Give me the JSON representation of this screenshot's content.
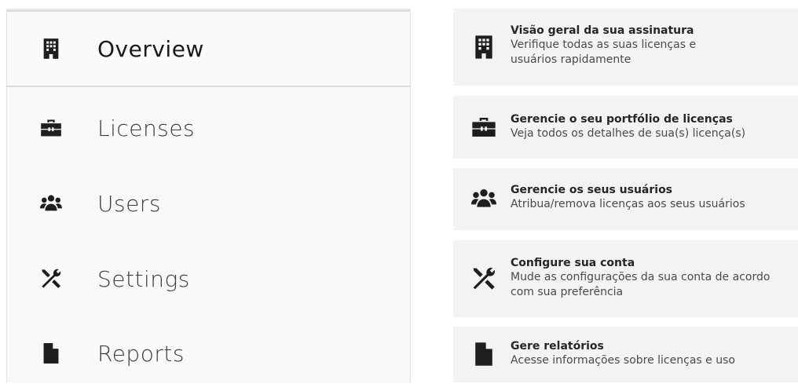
{
  "sidebar": {
    "items": [
      {
        "label": "Overview",
        "icon": "building-icon",
        "active": true
      },
      {
        "label": "Licenses",
        "icon": "toolbox-icon",
        "active": false
      },
      {
        "label": "Users",
        "icon": "users-icon",
        "active": false
      },
      {
        "label": "Settings",
        "icon": "tools-icon",
        "active": false
      },
      {
        "label": "Reports",
        "icon": "file-icon",
        "active": false
      }
    ]
  },
  "cards": [
    {
      "title": "Visão geral da sua assinatura",
      "desc": "Verifique todas as suas licenças e usuários rapidamente",
      "icon": "building-icon"
    },
    {
      "title": "Gerencie o seu portfólio de licenças",
      "desc": "Veja todos os detalhes de sua(s) licença(s)",
      "icon": "toolbox-icon"
    },
    {
      "title": "Gerencie os seus usuários",
      "desc": "Atribua/remova licenças aos seus usuários",
      "icon": "users-icon"
    },
    {
      "title": "Configure sua conta",
      "desc": "Mude as configurações da sua conta de acordo com sua preferência",
      "icon": "tools-icon"
    },
    {
      "title": "Gere relatórios",
      "desc": "Acesse informações sobre licenças e uso",
      "icon": "file-icon"
    }
  ],
  "colors": {
    "icon": "#1e1e1e",
    "card_bg": "#f3f3f3",
    "sidebar_bg": "#f9f9f9"
  }
}
